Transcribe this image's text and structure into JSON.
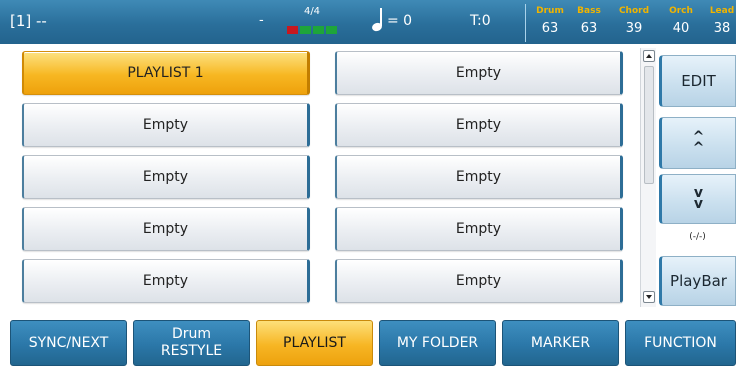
{
  "topbar": {
    "title": "[1] --",
    "dash": "-",
    "time_signature": "4/4",
    "beats": {
      "count": 4,
      "current": 1,
      "current_color": "#c8181f",
      "beat_color": "#1ea53a"
    },
    "tempo": "= 0",
    "transpose": "T:0",
    "mix": [
      {
        "name": "Drum",
        "value": "63"
      },
      {
        "name": "Bass",
        "value": "63"
      },
      {
        "name": "Chord",
        "value": "39"
      },
      {
        "name": "Orch",
        "value": "40"
      },
      {
        "name": "Lead",
        "value": "38"
      }
    ]
  },
  "playlist": {
    "slots": [
      {
        "label": "PLAYLIST 1",
        "active": true
      },
      {
        "label": "Empty"
      },
      {
        "label": "Empty"
      },
      {
        "label": "Empty"
      },
      {
        "label": "Empty"
      },
      {
        "label": "Empty"
      },
      {
        "label": "Empty"
      },
      {
        "label": "Empty"
      },
      {
        "label": "Empty"
      },
      {
        "label": "Empty"
      }
    ]
  },
  "side": {
    "edit": "EDIT",
    "page_indicator": "(-/-)",
    "playbar": "PlayBar"
  },
  "tabs": [
    {
      "label": "SYNC/NEXT",
      "sub": ""
    },
    {
      "label": "Drum",
      "sub": "RESTYLE"
    },
    {
      "label": "PLAYLIST",
      "sub": "",
      "active": true
    },
    {
      "label": "MY FOLDER",
      "sub": ""
    },
    {
      "label": "MARKER",
      "sub": ""
    },
    {
      "label": "FUNCTION",
      "sub": ""
    }
  ],
  "colors": {
    "header_blue": "#2a6f9b",
    "accent_orange": "#f7b722",
    "mix_label": "#f0b400"
  }
}
